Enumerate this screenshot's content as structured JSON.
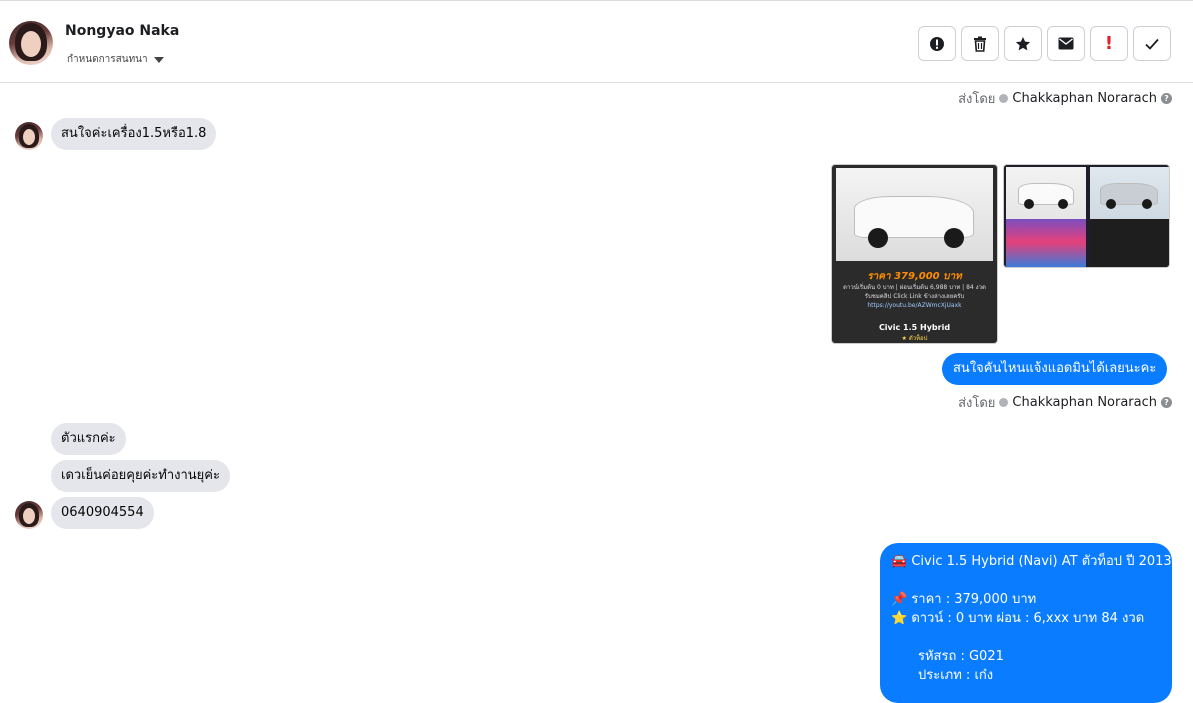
{
  "header": {
    "contact_name": "Nongyao Naka",
    "assign_label": "กำหนดการสนทนา",
    "toolbar": [
      {
        "name": "info-button",
        "icon": "info-circle-icon",
        "glyph": "ⓘ"
      },
      {
        "name": "delete-button",
        "icon": "trash-icon",
        "glyph": "🗑"
      },
      {
        "name": "star-button",
        "icon": "star-icon",
        "glyph": "★"
      },
      {
        "name": "mark-unread-button",
        "icon": "envelope-icon",
        "glyph": "✉"
      },
      {
        "name": "follow-up-button",
        "icon": "exclamation-icon",
        "glyph": "!"
      },
      {
        "name": "done-button",
        "icon": "check-icon",
        "glyph": "✓"
      }
    ]
  },
  "messages": {
    "sent_by_label": "ส่งโดย",
    "sent_by_name": "Chakkaphan Norarach",
    "in_1": "สนใจค่ะเครื่อง1.5หรือ1.8",
    "out_1": "สนใจคันไหนแจ้งแอดมินได้เลยนะคะ",
    "in_2": "ตัวแรกค่ะ",
    "in_3": "เดวเย็นค่อยคุยค่ะทำงานยุค่ะ",
    "in_4": "0640904554",
    "card1": {
      "price": "ราคา 379,000 บาท",
      "line1": "ดาวน์เริ่มต้น 0 บาท | ผ่อนเริ่มต้น 6,988 บาท | 84 งวด",
      "line2": "รับชมคลิป Click Link ข้างล่างเลยครับ",
      "line3": "https://youtu.be/AZWmcXjUaxk",
      "title": "Civic 1.5 Hybrid",
      "tag": "★ ตัวท็อป"
    },
    "long": {
      "l1": "🚘 Civic 1.5 Hybrid (Navi) AT ตัวท็อป ปี 2013",
      "l2": "📌 ราคา : 379,000 บาท",
      "l3": "⭐ ดาวน์ : 0 บาท ผ่อน : 6,xxx บาท 84 งวด",
      "l4": "รหัสรถ : G021",
      "l5": "ประเภท : เก๋ง"
    }
  }
}
